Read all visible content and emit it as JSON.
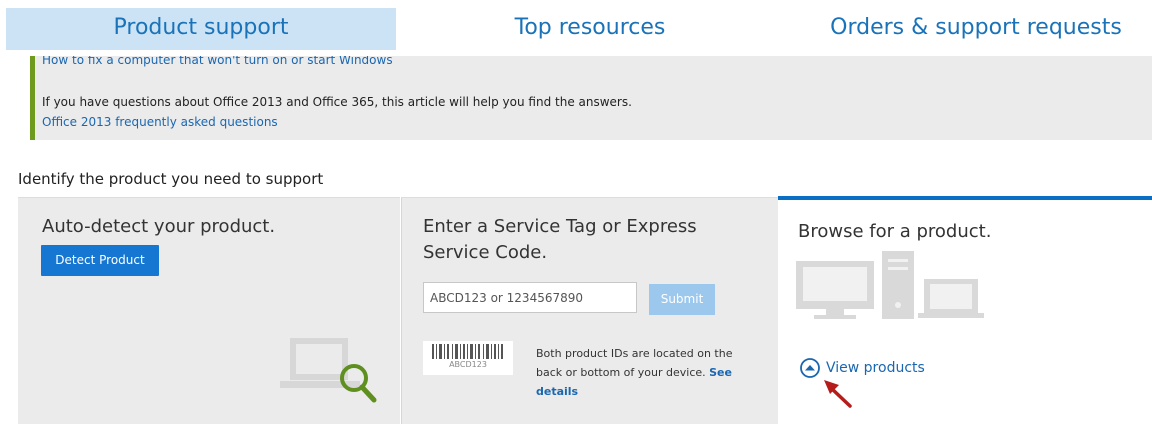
{
  "tabs": [
    {
      "label": "Product support",
      "active": true
    },
    {
      "label": "Top resources",
      "active": false
    },
    {
      "label": "Orders & support requests",
      "active": false
    }
  ],
  "alert": {
    "cut_link": "How to fix a computer that won't turn on or start Windows",
    "office_text": "If you have questions about Office 2013 and Office 365, this article will help you find the answers.",
    "office_link": "Office 2013 frequently asked questions"
  },
  "identify_heading": "Identify the product you need to support",
  "auto_detect": {
    "title": "Auto-detect your product.",
    "button": "Detect Product",
    "icon": "laptop-magnifier-icon"
  },
  "service_tag": {
    "title": "Enter a Service Tag or Express Service Code.",
    "input_value": "",
    "input_placeholder": "ABCD123 or 1234567890",
    "submit": "Submit",
    "barcode_code": "ABCD123",
    "info_text": "Both product IDs are located on the back or bottom of your device.",
    "info_link": "See details"
  },
  "browse": {
    "title": "Browse for a product.",
    "icon": "desktop-laptop-icon",
    "view_link": "View products"
  },
  "colors": {
    "accent_blue": "#0a6fc2",
    "button_blue": "#1577d2",
    "link_blue": "#1a67b0",
    "alert_bar_green": "#6e9a1e",
    "tab_active_bg": "#cbe3f5"
  }
}
